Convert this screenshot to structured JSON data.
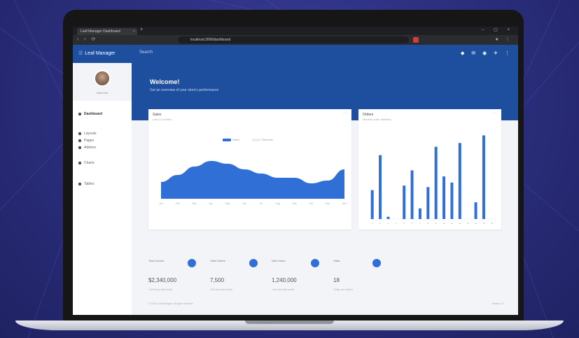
{
  "browser": {
    "tab_title": "Leaf Manager Dashboard",
    "tab_close": "×",
    "new_tab": "+",
    "window_controls": "– ▢ ×",
    "nav_buttons": "‹ › ⟳",
    "url": "localhost:3000/dashboard",
    "extensions": "★ ⋮"
  },
  "topnav": {
    "brand_icon": "☰",
    "brand": "Leaf Manager",
    "search": "Search",
    "right_icons": "◆ ✉ ◉ ✈ ⋮"
  },
  "sidebar": {
    "user_name": "Jane Doe",
    "items": [
      {
        "label": "Dashboard",
        "active": true
      },
      {
        "label": "Layouts",
        "active": false
      },
      {
        "label": "Pages",
        "active": false
      },
      {
        "label": "Addons",
        "active": false
      },
      {
        "label": "Charts",
        "active": false
      },
      {
        "label": "Tables",
        "active": false
      }
    ]
  },
  "hero": {
    "title": "Welcome!",
    "subtitle": "Get an overview of your store's performance"
  },
  "area_card": {
    "title": "Sales",
    "subtitle": "Last 12 months",
    "menu": "⋯",
    "legend": [
      "Sales",
      "Revenue"
    ]
  },
  "bar_card": {
    "title": "Orders",
    "subtitle": "Monthly order statistics",
    "menu": "⋯"
  },
  "chart_data": [
    {
      "type": "area",
      "title": "Sales",
      "x": [
        "Jan",
        "Feb",
        "Mar",
        "Apr",
        "May",
        "Jun",
        "Jul",
        "Aug",
        "Sep",
        "Oct",
        "Nov",
        "Dec"
      ],
      "series": [
        {
          "name": "Sales",
          "values": [
            24,
            34,
            46,
            54,
            50,
            42,
            36,
            30,
            30,
            22,
            26,
            42
          ]
        }
      ],
      "ylim": [
        0,
        100
      ],
      "color": "#2f6fd6"
    },
    {
      "type": "bar",
      "title": "Orders",
      "categories": [
        "1",
        "2",
        "3",
        "4",
        "5",
        "6",
        "7",
        "8",
        "9",
        "10",
        "11",
        "12",
        "13",
        "14",
        "15",
        "16"
      ],
      "values": [
        38,
        84,
        3,
        0,
        44,
        64,
        14,
        42,
        95,
        56,
        48,
        100,
        0,
        22,
        110,
        0
      ],
      "ylim": [
        0,
        115
      ],
      "color": "#2f6fd6"
    }
  ],
  "stats": [
    {
      "label": "Total Income",
      "value": "$2,340,000",
      "meta": "+12% from last month"
    },
    {
      "label": "Total Orders",
      "value": "7,500",
      "meta": "+8% from last month"
    },
    {
      "label": "New Users",
      "value": "1,240,000",
      "meta": "+4% from last month"
    },
    {
      "label": "Visits",
      "value": "18",
      "meta": "Today, live visitors"
    }
  ],
  "footer": {
    "left": "© 2019 Leaf Manager. All rights reserved.",
    "right": "Version 1.0"
  },
  "colors": {
    "primary": "#1e4e9e",
    "accent": "#2f6fd6",
    "background": "#2a2d7a"
  }
}
